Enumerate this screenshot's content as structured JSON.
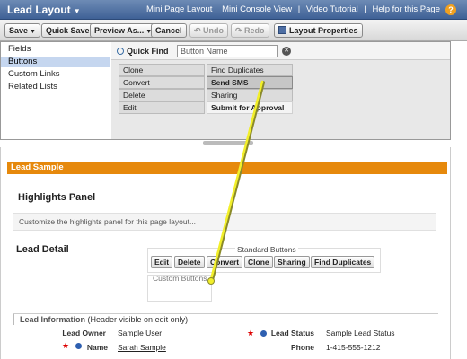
{
  "header": {
    "title": "Lead Layout",
    "links": [
      "Mini Page Layout",
      "Mini Console View",
      "Video Tutorial",
      "Help for this Page"
    ],
    "help_icon": "?"
  },
  "toolbar": {
    "save": "Save",
    "quick_save": "Quick Save",
    "preview_as": "Preview As...",
    "cancel": "Cancel",
    "undo": "Undo",
    "redo": "Redo",
    "layout_properties": "Layout Properties"
  },
  "palette": {
    "categories": [
      "Fields",
      "Buttons",
      "Custom Links",
      "Related Lists"
    ],
    "selected_category": "Buttons",
    "quick_find_label": "Quick Find",
    "quick_find_placeholder": "Button Name",
    "items": {
      "clone": "Clone",
      "find_duplicates": "Find Duplicates",
      "convert": "Convert",
      "send_sms": "Send SMS",
      "delete": "Delete",
      "sharing": "Sharing",
      "edit": "Edit",
      "submit_for_approval": "Submit for Approval"
    }
  },
  "layout": {
    "section_title": "Lead Sample",
    "highlights_title": "Highlights Panel",
    "highlights_hint": "Customize the highlights panel for this page layout...",
    "lead_detail_title": "Lead Detail",
    "standard_buttons_label": "Standard Buttons",
    "standard_buttons": [
      "Edit",
      "Delete",
      "Convert",
      "Clone",
      "Sharing",
      "Find Duplicates"
    ],
    "custom_buttons_label": "Custom Buttons",
    "lead_info_title": "Lead Information",
    "lead_info_note": "(Header visible on edit only)",
    "fields": {
      "lead_owner_label": "Lead Owner",
      "lead_owner_value": "Sample User",
      "name_label": "Name",
      "name_value": "Sarah Sample",
      "lead_status_label": "Lead Status",
      "lead_status_value": "Sample Lead Status",
      "phone_label": "Phone",
      "phone_value": "1-415-555-1212"
    }
  },
  "colors": {
    "accent_orange": "#e6890c",
    "header_blue": "#3f6196",
    "arrow_yellow": "#f2ef2a"
  }
}
